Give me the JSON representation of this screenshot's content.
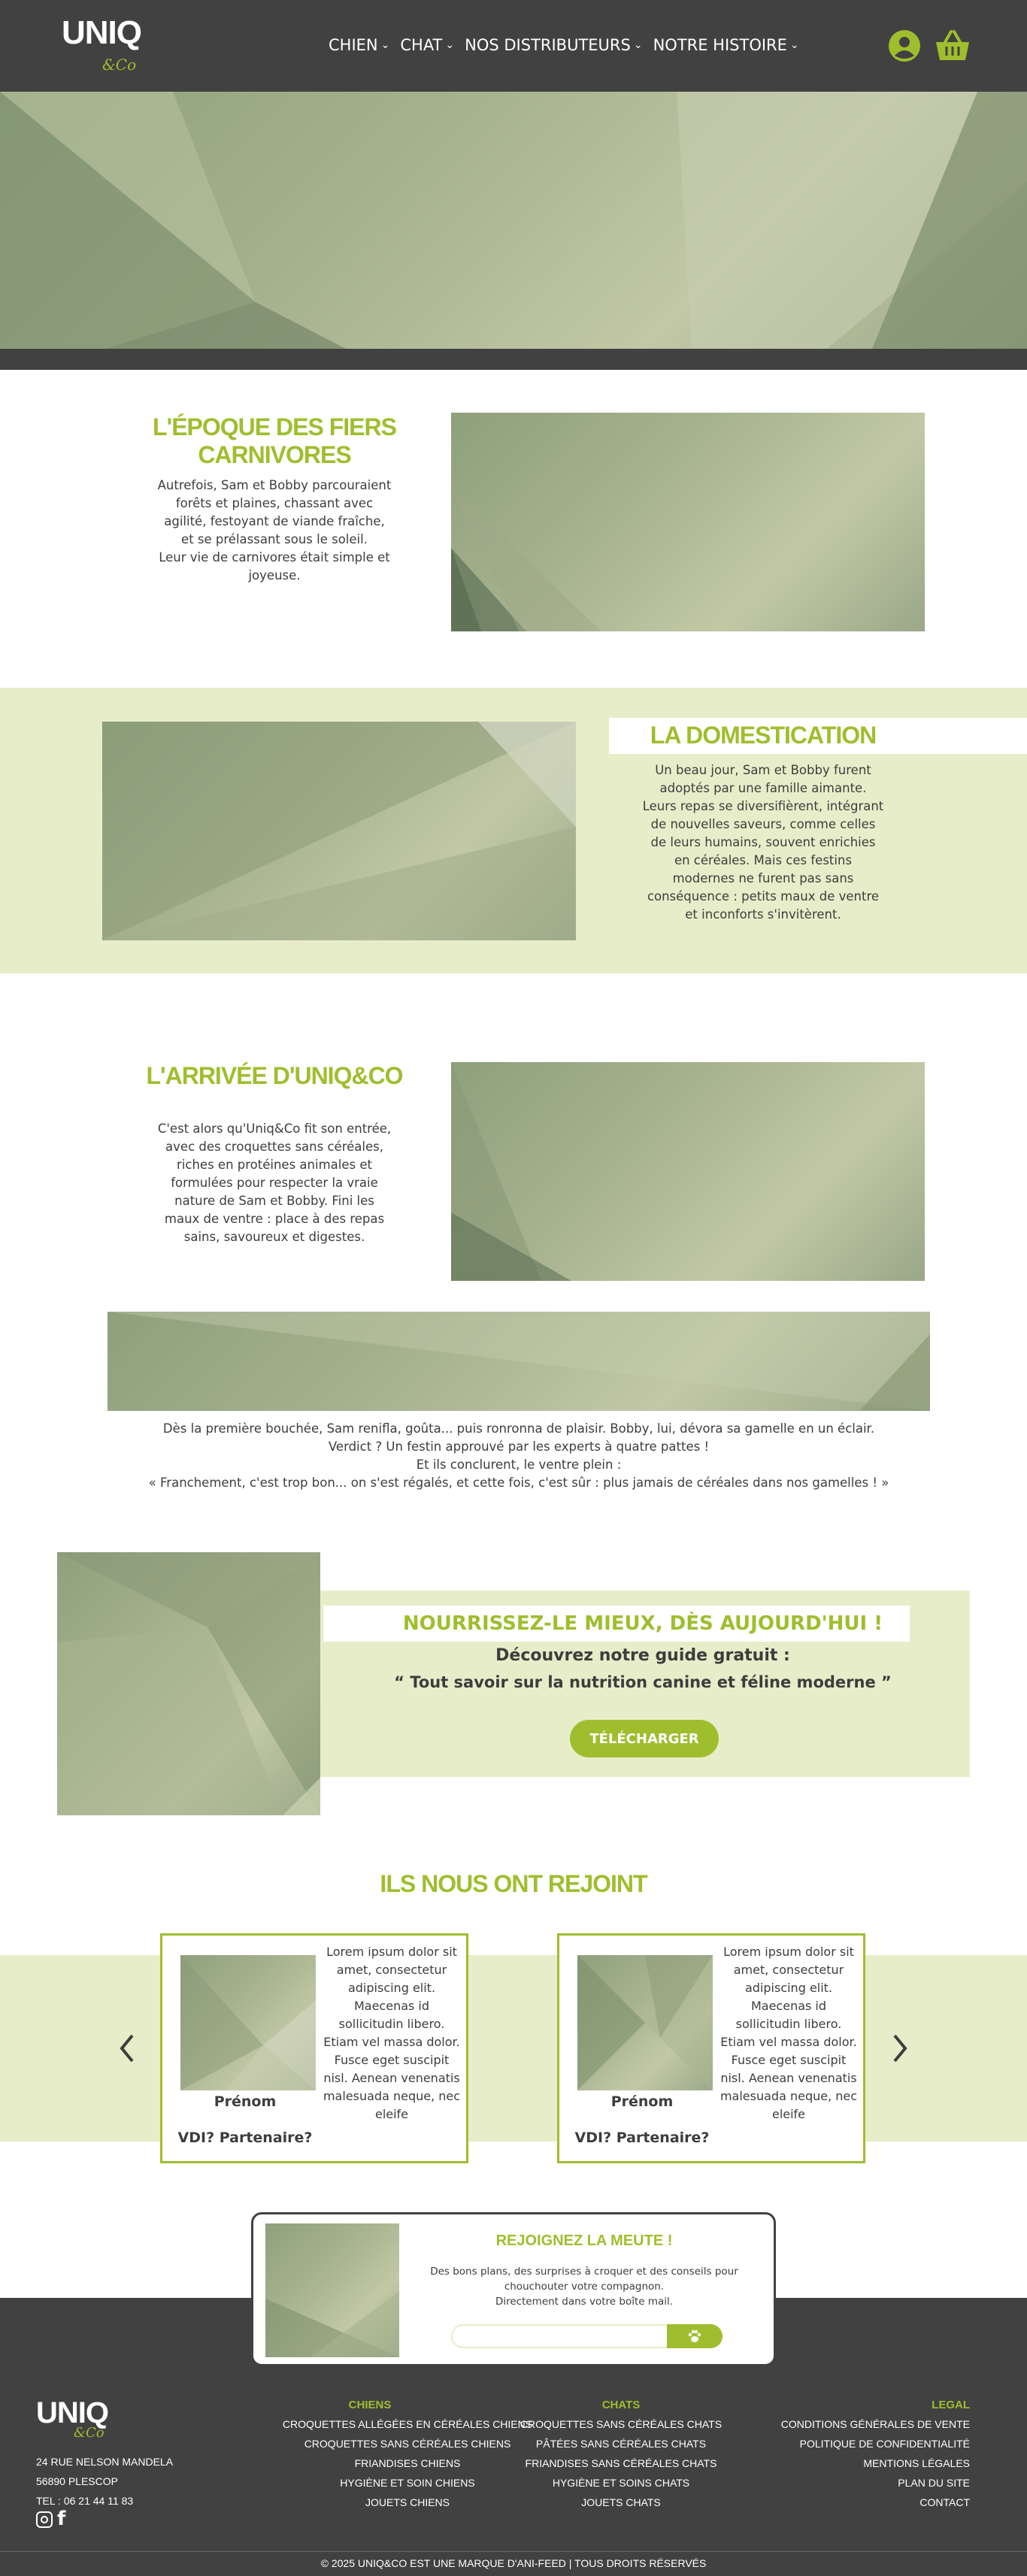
{
  "header": {
    "logo_main": "UNIQ",
    "logo_sub": "&Co",
    "nav": [
      {
        "label": "CHIEN"
      },
      {
        "label": "CHAT"
      },
      {
        "label": "NOS DISTRIBUTEURS"
      },
      {
        "label": "NOTRE HISTOIRE"
      }
    ],
    "icons": [
      "user-icon",
      "basket-icon"
    ]
  },
  "story": {
    "s1": {
      "title": "L'ÉPOQUE DES FIERS CARNIVORES",
      "lines": [
        "Autrefois, Sam et Bobby parcouraient",
        "forêts et plaines, chassant avec",
        "agilité, festoyant de viande fraîche,",
        "et se prélassant sous le soleil.",
        "Leur vie de carnivores était simple et",
        "joyeuse."
      ]
    },
    "s2": {
      "title": "LA DOMESTICATION",
      "lines": [
        "Un beau jour, Sam et Bobby furent",
        "adoptés par une famille aimante.",
        "Leurs repas se diversifièrent, intégrant",
        "de nouvelles saveurs, comme celles",
        "de leurs humains, souvent enrichies",
        "en céréales. Mais ces festins",
        "modernes ne furent pas sans",
        "conséquence : petits maux de ventre",
        "et inconforts s'invitèrent."
      ]
    },
    "s3": {
      "title": "L'ARRIVÉE D'UNIQ&CO",
      "lines": [
        "C'est alors qu'Uniq&Co fit son entrée,",
        "avec des croquettes sans céréales,",
        "riches en protéines animales et",
        "formulées pour respecter la vraie",
        "nature de Sam et Bobby. Fini les",
        "maux de ventre : place à des repas",
        "sains, savoureux et digestes."
      ]
    },
    "s4": {
      "lines": [
        "Dès la première bouchée, Sam renifla, goûta... puis ronronna de plaisir. Bobby, lui, dévora sa gamelle en un éclair.",
        "Verdict ? Un festin approuvé par les experts à quatre pattes !",
        "Et ils conclurent, le ventre plein :",
        "« Franchement, c'est trop bon... on s'est régalés, et cette fois, c'est sûr : plus jamais de céréales dans nos gamelles ! »"
      ]
    }
  },
  "guide": {
    "title": "NOURRISSEZ-LE MIEUX, DÈS AUJOURD'HUI !",
    "subtitle": "Découvrez notre guide gratuit :",
    "quote": "“ Tout savoir sur la nutrition canine et féline moderne ”",
    "button": "TÉLÉCHARGER"
  },
  "partners": {
    "title": "ILS NOUS ONT REJOINT",
    "cards": [
      {
        "name": "Prénom",
        "role": "VDI? Partenaire?",
        "text": "Lorem ipsum dolor sit amet, consectetur adipiscing elit. Maecenas id sollicitudin libero. Etiam vel massa dolor. Fusce eget suscipit nisl. Aenean venenatis malesuada neque, nec eleife"
      },
      {
        "name": "Prénom",
        "role": "VDI? Partenaire?",
        "text": "Lorem ipsum dolor sit amet, consectetur adipiscing elit. Maecenas id sollicitudin libero. Etiam vel massa dolor. Fusce eget suscipit nisl. Aenean venenatis malesuada neque, nec eleife"
      }
    ],
    "prev_icon": "chevron-left-icon",
    "next_icon": "chevron-right-icon"
  },
  "newsletter": {
    "title": "REJOIGNEZ LA MEUTE !",
    "lines": [
      "Des bons plans, des surprises à croquer et des conseils pour",
      "chouchouter votre compagnon.",
      "Directement dans votre boîte mail."
    ],
    "placeholder": "",
    "submit_icon": "paw-icon"
  },
  "footer": {
    "logo_main": "UNIQ",
    "logo_sub": "&Co",
    "address": [
      "24 RUE NELSON MANDELA",
      "56890 PLESCOP",
      "TEL : 06 21 44 11 83"
    ],
    "social": [
      "instagram-icon",
      "facebook-icon"
    ],
    "chiens": {
      "title": "CHIENS",
      "links": [
        "CROQUETTES ALLÉGÉES EN CÉRÉALES CHIENS",
        "CROQUETTES SANS CÉRÉALES CHIENS",
        "FRIANDISES CHIENS",
        "HYGIÈNE ET SOIN CHIENS",
        "JOUETS CHIENS"
      ]
    },
    "chats": {
      "title": "CHATS",
      "links": [
        "CROQUETTES SANS CÉRÉALES CHATS",
        "PÂTÉES SANS CÉRÉALES CHATS",
        "FRIANDISES SANS CÉRÉALES CHATS",
        "HYGIÈNE ET SOINS CHATS",
        "JOUETS CHATS"
      ]
    },
    "legal": {
      "title": "LEGAL",
      "links": [
        "CONDITIONS GÉNÉRALES DE VENTE",
        "POLITIQUE DE CONFIDENTIALITÉ",
        "MENTIONS LÉGALES",
        "PLAN DU SITE",
        "CONTACT"
      ]
    },
    "copyright": "© 2025 UNIQ&CO EST UNE MARQUE D'ANI-FEED | TOUS DROITS RÉSERVÉS"
  },
  "colors": {
    "accent": "#9fbe2e",
    "dark": "#414141",
    "band": "#e8edc9"
  }
}
